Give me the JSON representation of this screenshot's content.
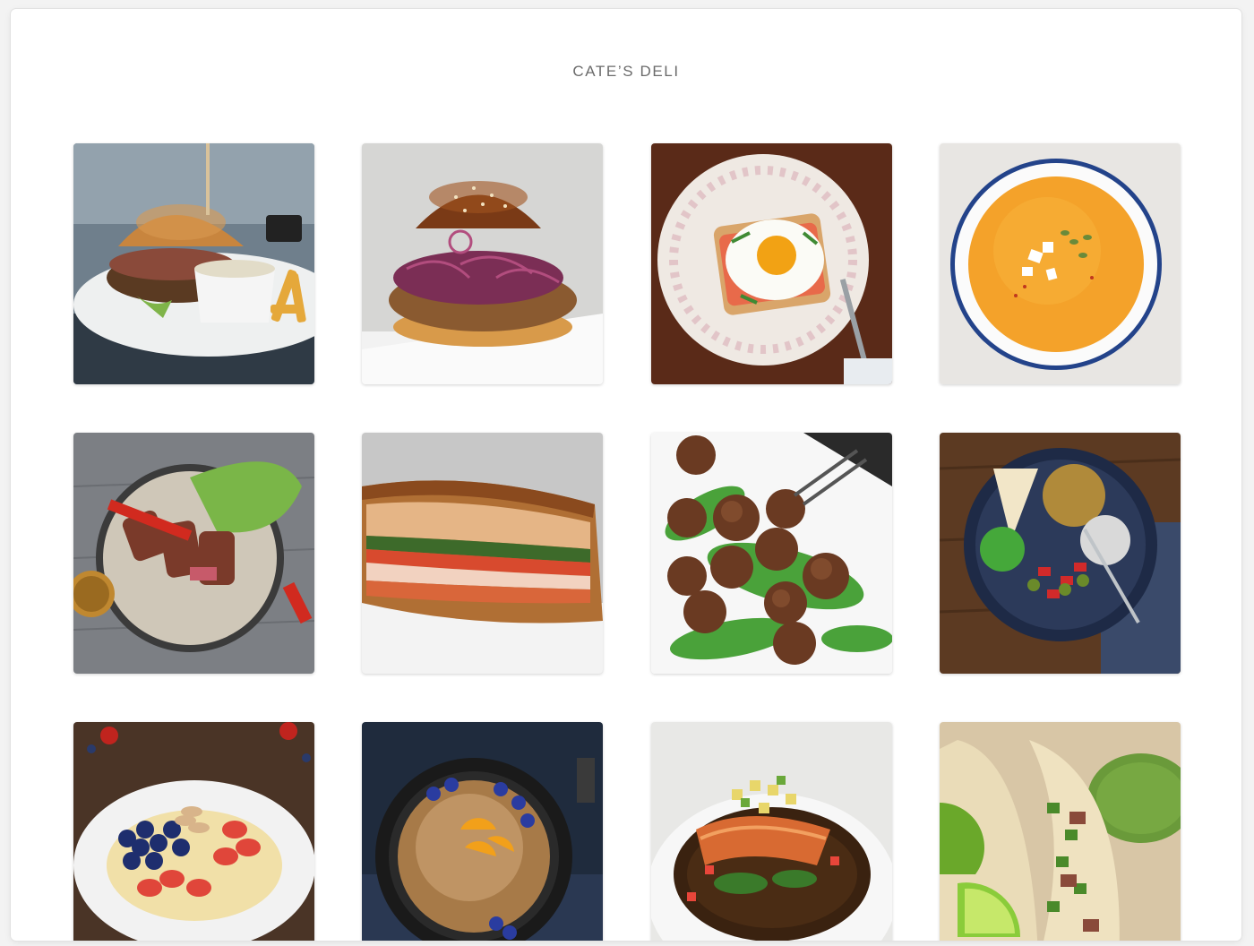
{
  "header": {
    "title": "CATE’S DELI"
  },
  "gallery": {
    "items": [
      {
        "name": "burger-with-fries",
        "icon": "burger-photo"
      },
      {
        "name": "fried-chicken-sandwich",
        "icon": "sandwich-photo"
      },
      {
        "name": "egg-toast",
        "icon": "egg-photo"
      },
      {
        "name": "pumpkin-soup",
        "icon": "soup-photo"
      },
      {
        "name": "steak-salad",
        "icon": "steak-photo"
      },
      {
        "name": "deli-sub",
        "icon": "sub-photo"
      },
      {
        "name": "meatballs-arugula",
        "icon": "meatball-photo"
      },
      {
        "name": "grain-bowl",
        "icon": "bowl-photo"
      },
      {
        "name": "porridge-berries",
        "icon": "porridge-photo"
      },
      {
        "name": "pancake-skillet",
        "icon": "pancake-photo"
      },
      {
        "name": "salmon-plate",
        "icon": "salmon-photo"
      },
      {
        "name": "tacos-lime",
        "icon": "taco-photo"
      }
    ]
  },
  "colors": {
    "title": "#6b6b6b",
    "background": "#ffffff"
  }
}
